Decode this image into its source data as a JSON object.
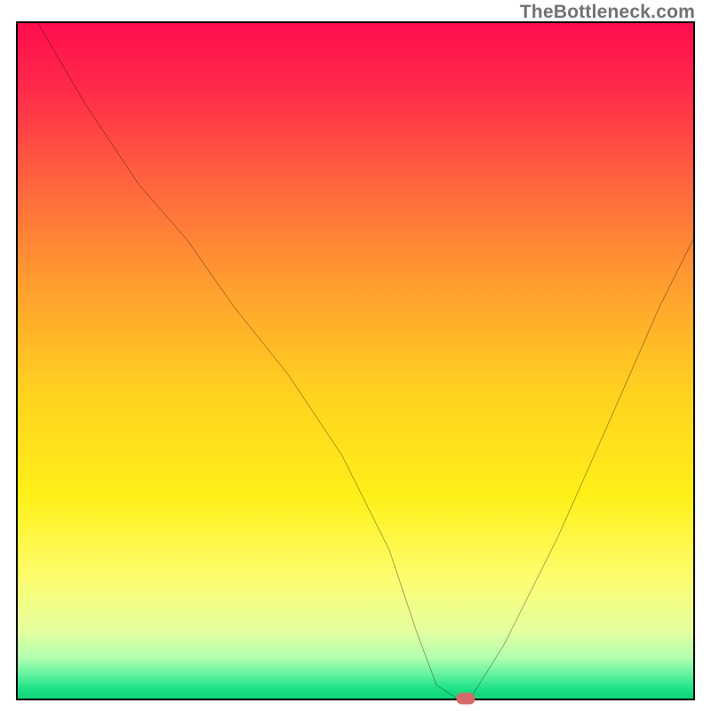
{
  "watermark": "TheBottleneck.com",
  "chart_data": {
    "type": "line",
    "title": "",
    "xlabel": "",
    "ylabel": "",
    "xlim": [
      0,
      100
    ],
    "ylim": [
      0,
      100
    ],
    "grid": false,
    "legend": false,
    "series": [
      {
        "name": "bottleneck-curve",
        "color": "#000000",
        "x": [
          3,
          10,
          18,
          25,
          32,
          40,
          48,
          55,
          59,
          62,
          65,
          67,
          72,
          80,
          88,
          95,
          100
        ],
        "y": [
          100,
          88,
          76,
          68,
          58,
          48,
          36,
          22,
          10,
          2,
          0,
          0,
          8,
          24,
          42,
          58,
          68
        ]
      }
    ],
    "marker": {
      "x": 66,
      "y": 0,
      "color": "#d46a6a"
    },
    "background_gradient": {
      "stops": [
        {
          "pos": 0.0,
          "color": "#ff0d4e"
        },
        {
          "pos": 0.1,
          "color": "#ff2b4a"
        },
        {
          "pos": 0.25,
          "color": "#ff6a3d"
        },
        {
          "pos": 0.4,
          "color": "#ffa22e"
        },
        {
          "pos": 0.55,
          "color": "#ffd21f"
        },
        {
          "pos": 0.7,
          "color": "#fff018"
        },
        {
          "pos": 0.82,
          "color": "#fdfd6e"
        },
        {
          "pos": 0.9,
          "color": "#e6ffa0"
        },
        {
          "pos": 0.94,
          "color": "#b0ffb0"
        },
        {
          "pos": 0.965,
          "color": "#60f29f"
        },
        {
          "pos": 0.985,
          "color": "#1fe288"
        },
        {
          "pos": 1.0,
          "color": "#0fd47a"
        }
      ]
    }
  }
}
